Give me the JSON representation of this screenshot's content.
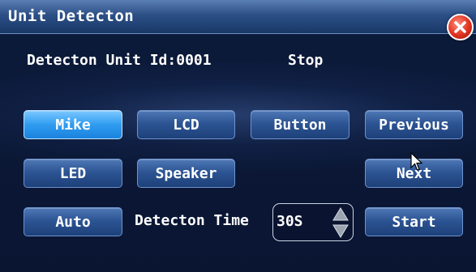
{
  "window": {
    "title": "Unit Detecton",
    "close_icon": "close-icon"
  },
  "status": {
    "label": "Detecton Unit Id:0001",
    "state": "Stop"
  },
  "buttons": {
    "mike": "Mike",
    "lcd": "LCD",
    "button": "Button",
    "previous": "Previous",
    "led": "LED",
    "speaker": "Speaker",
    "next": "Next",
    "auto": "Auto",
    "start": "Start"
  },
  "detection_time": {
    "label": "Detecton Time",
    "value": "30S"
  },
  "colors": {
    "title_bar": "#2c4f86",
    "background": "#0a1530",
    "button": "#2d5594",
    "button_active": "#2f9cf0",
    "close": "#e0321f"
  }
}
